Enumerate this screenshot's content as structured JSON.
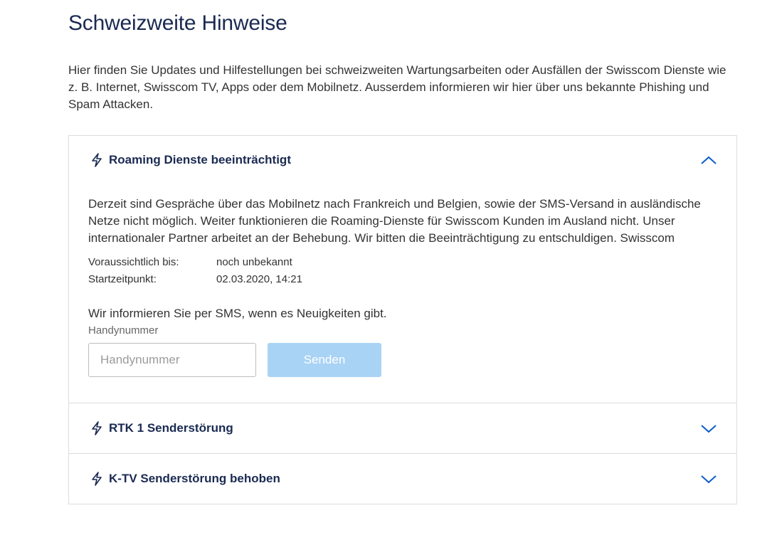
{
  "page": {
    "title": "Schweizweite Hinweise",
    "intro": "Hier finden Sie Updates und Hilfestellungen bei schweizweiten Wartungsarbeiten oder Ausfällen der Swisscom Dienste wie z. B. Internet, Swisscom TV, Apps oder dem Mobilnetz. Ausserdem informieren wir hier über uns bekannte Phishing und Spam Attacken."
  },
  "accordion": {
    "items": [
      {
        "title": "Roaming Dienste beeinträchtigt",
        "expanded": true,
        "icon": "lightning-icon",
        "text": "Derzeit sind Gespräche über das Mobilnetz nach Frankreich und Belgien, sowie der SMS-Versand in ausländische Netze nicht möglich. Weiter funktionieren die Roaming-Dienste für Swisscom Kunden im Ausland nicht. Unser internationaler Partner arbeitet an der Behebung. Wir bitten die Beeinträchtigung zu entschuldigen. Swisscom",
        "expected_label": "Voraussichtlich bis:",
        "expected_value": "noch unbekannt",
        "start_label": "Startzeitpunkt:",
        "start_value": "02.03.2020, 14:21",
        "sms_note": "Wir informieren Sie per SMS, wenn es Neuigkeiten gibt.",
        "phone_label": "Handynummer",
        "phone_placeholder": "Handynummer",
        "phone_value": "",
        "send_label": "Senden"
      },
      {
        "title": "RTK 1 Senderstörung",
        "expanded": false,
        "icon": "lightning-icon"
      },
      {
        "title": "K-TV Senderstörung behoben",
        "expanded": false,
        "icon": "lightning-icon"
      }
    ]
  },
  "colors": {
    "title": "#1a2a52",
    "accent": "#0a5ec7",
    "button_disabled": "#a9d3f5",
    "border": "#dcdcdc"
  }
}
